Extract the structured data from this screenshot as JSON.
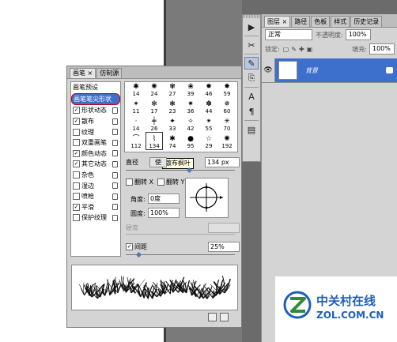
{
  "toolbar": {
    "icons": [
      "play-icon",
      "tools-icon",
      "brush-icon",
      "clone-icon",
      "text-icon",
      "paragraph-icon",
      "layers-icon"
    ]
  },
  "layers_panel": {
    "tabs": [
      "图层 ×",
      "路径",
      "色板",
      "样式",
      "历史记录"
    ],
    "blend_mode": "正常",
    "opacity_label": "不透明度:",
    "opacity_value": "100%",
    "lock_label": "锁定:",
    "fill_label": "填充:",
    "fill_value": "100%",
    "layer_name": "背景"
  },
  "brush_panel": {
    "tabs": [
      "画笔 ×",
      "仿制源"
    ],
    "options": [
      {
        "label": "画笔预设",
        "checked": null,
        "highlight": false
      },
      {
        "label": "画笔笔尖形状",
        "checked": null,
        "highlight": true
      },
      {
        "label": "形状动态",
        "checked": true,
        "highlight": false
      },
      {
        "label": "散布",
        "checked": true,
        "highlight": false
      },
      {
        "label": "纹理",
        "checked": false,
        "highlight": false
      },
      {
        "label": "双重画笔",
        "checked": false,
        "highlight": false
      },
      {
        "label": "颜色动态",
        "checked": true,
        "highlight": false
      },
      {
        "label": "其它动态",
        "checked": true,
        "highlight": false
      },
      {
        "label": "杂色",
        "checked": false,
        "highlight": false
      },
      {
        "label": "湿边",
        "checked": false,
        "highlight": false
      },
      {
        "label": "喷枪",
        "checked": false,
        "highlight": false
      },
      {
        "label": "平滑",
        "checked": true,
        "highlight": false
      },
      {
        "label": "保护纹理",
        "checked": false,
        "highlight": false
      }
    ],
    "tip_grid": [
      [
        "14",
        "24",
        "27",
        "39",
        "46",
        "59"
      ],
      [
        "11",
        "17",
        "23",
        "36",
        "44",
        "60"
      ],
      [
        "14",
        "26",
        "33",
        "42",
        "55",
        "70"
      ],
      [
        "112",
        "134",
        "74",
        "95",
        "29",
        "192"
      ]
    ],
    "selected_tip": "134",
    "tooltip": "散布枫叶",
    "diameter_label": "直径",
    "diameter_button": "使",
    "diameter_value": "134 px",
    "flip_x_label": "翻转 X",
    "flip_y_label": "翻转 Y",
    "angle_label": "角度:",
    "angle_value": "0度",
    "roundness_label": "圆度:",
    "roundness_value": "100%",
    "hardness_label": "硬度",
    "spacing_label": "间距",
    "spacing_checked": true,
    "spacing_value": "25%"
  },
  "watermark": {
    "cn": "中关村在线",
    "en": "ZOL.COM.CN"
  },
  "colors": {
    "accent": "#3d6fcd",
    "panel": "#d4d4d4",
    "highlight_ring": "#cc0000",
    "brand": "#1c5fb8"
  }
}
